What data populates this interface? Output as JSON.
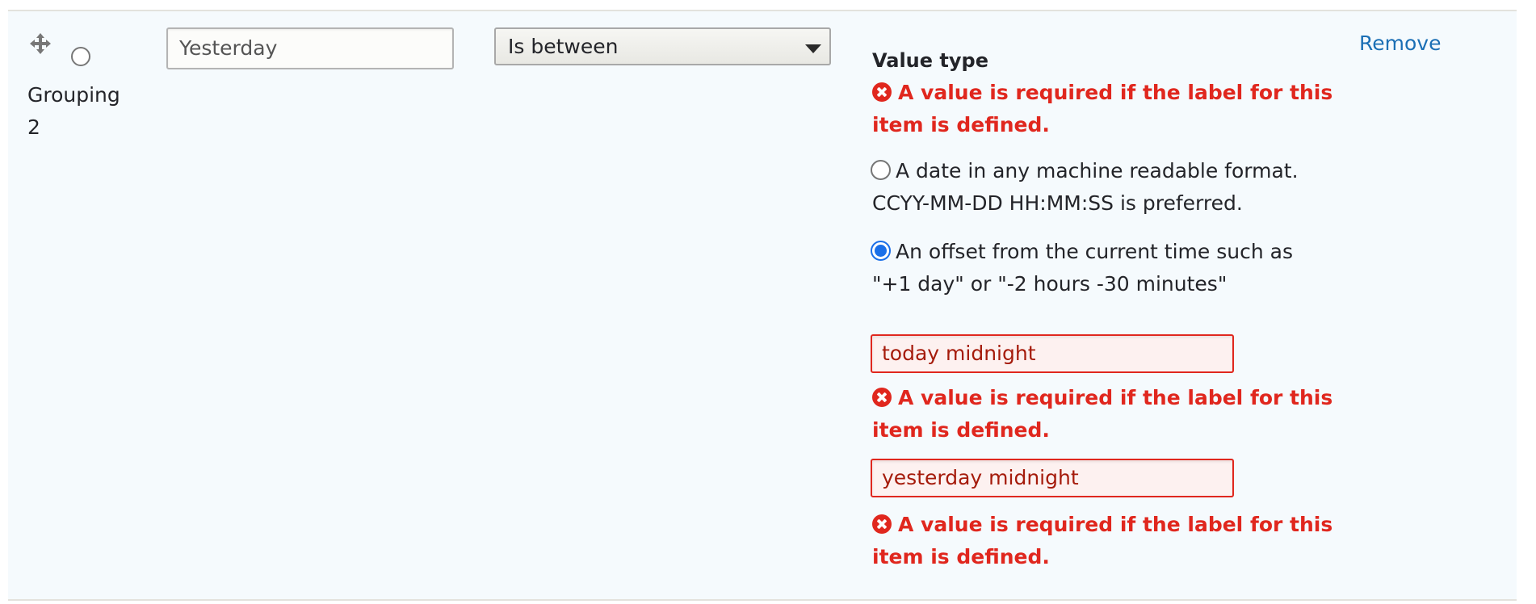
{
  "row": {
    "drag_handle_icon": "move-arrows-icon",
    "default_radio_checked": false,
    "grouping_label_lines": [
      "Grouping",
      "2"
    ],
    "label_input_value": "Yesterday",
    "operator_select_value": "Is between",
    "remove_link": "Remove"
  },
  "value_type": {
    "label": "Value type",
    "error_lines": [
      "A value is required if the label for this",
      "item is defined."
    ],
    "options": [
      {
        "lines": [
          "A date in any machine readable format.",
          "CCYY-MM-DD HH:MM:SS is preferred."
        ],
        "checked": false
      },
      {
        "lines": [
          "An offset from the current time such as",
          "\"+1 day\" or \"-2 hours -30 minutes\""
        ],
        "checked": true
      }
    ]
  },
  "values": {
    "min_value": "today midnight",
    "min_error_lines": [
      "A value is required if the label for this",
      "item is defined."
    ],
    "max_value": "yesterday midnight",
    "max_error_lines": [
      "A value is required if the label for this",
      "item is defined."
    ]
  },
  "colors": {
    "error": "#e0271e",
    "link": "#1b6fb5",
    "radio_checked": "#1a6fe8",
    "panel_bg": "#f5fafd"
  }
}
